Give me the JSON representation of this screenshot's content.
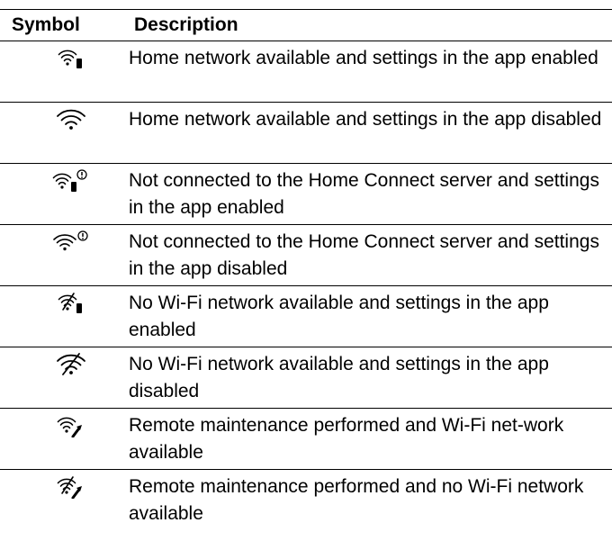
{
  "headers": {
    "symbol": "Symbol",
    "description": "Description"
  },
  "rows": [
    {
      "icon": "wifi-phone-icon",
      "description": "Home network available and settings in the app enabled"
    },
    {
      "icon": "wifi-icon",
      "description": "Home network available and settings in the app disabled"
    },
    {
      "icon": "wifi-phone-alert-icon",
      "description": "Not connected to the Home Connect server and settings in the app enabled"
    },
    {
      "icon": "wifi-alert-icon",
      "description": "Not connected to the Home Connect server and settings in the app disabled"
    },
    {
      "icon": "wifi-off-phone-icon",
      "description": "No Wi-Fi network available and settings in the app enabled"
    },
    {
      "icon": "wifi-off-icon",
      "description": "No Wi-Fi network available and settings in the app disabled"
    },
    {
      "icon": "wifi-wrench-icon",
      "description": "Remote maintenance performed and Wi-Fi net-work available"
    },
    {
      "icon": "wifi-off-wrench-icon",
      "description": "Remote maintenance performed and no Wi-Fi network available"
    }
  ]
}
